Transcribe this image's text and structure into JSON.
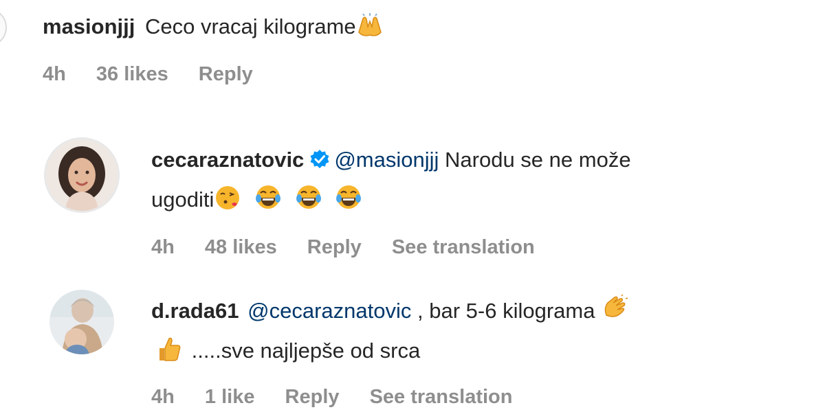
{
  "comments": [
    {
      "username": "masionjjj",
      "text": "Ceco vracaj kilograme",
      "emoji_icons": [
        "raising-hands-icon"
      ],
      "time": "4h",
      "likes": "36 likes",
      "reply": "Reply"
    },
    {
      "username": "cecaraznatovic",
      "verified": true,
      "mention": "@masionjjj",
      "text_line1": "Narodu se ne može",
      "text_line2": "ugoditi",
      "emoji_icons": [
        "face-blowing-kiss-icon",
        "tears-of-joy-icon",
        "tears-of-joy-icon",
        "tears-of-joy-icon"
      ],
      "time": "4h",
      "likes": "48 likes",
      "reply": "Reply",
      "see_translation": "See translation"
    },
    {
      "username": "d.rada61",
      "mention": "@cecaraznatovic",
      "text_line1": " , bar 5-6 kilograma",
      "text_line2": ".....sve najljepše od srca",
      "emoji_icons": [
        "clapping-hands-icon",
        "thumbs-up-icon"
      ],
      "time": "4h",
      "likes": "1 like",
      "reply": "Reply",
      "see_translation": "See translation"
    }
  ],
  "colors": {
    "primary_text": "#262626",
    "secondary_text": "#8e8e8e",
    "mention": "#00376b",
    "verified": "#0095f6"
  }
}
